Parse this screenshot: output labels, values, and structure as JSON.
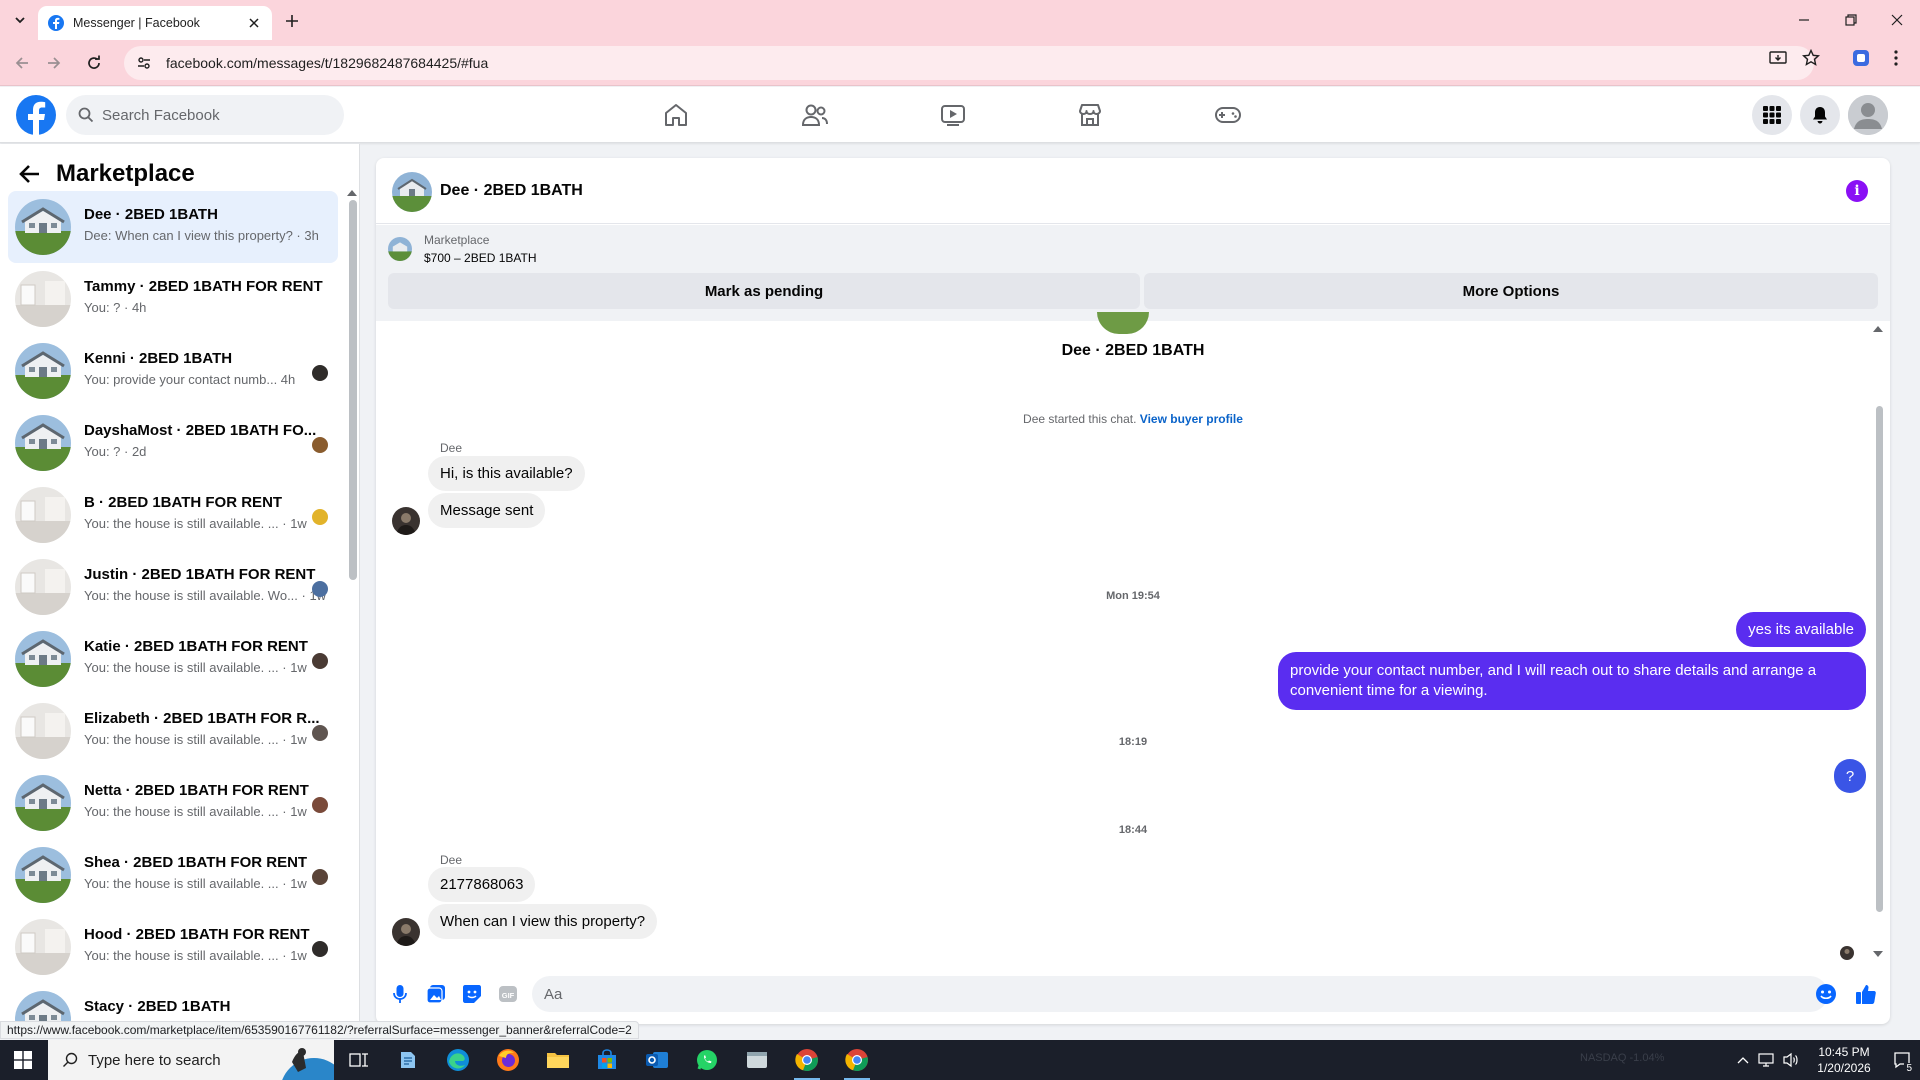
{
  "browser": {
    "tab_title": "Messenger | Facebook",
    "url": "facebook.com/messages/t/1829682487684425/#fua",
    "status_url": "https://www.facebook.com/marketplace/item/653590167761182/?referralSurface=messenger_banner&referralCode=2"
  },
  "header": {
    "search_placeholder": "Search Facebook",
    "nav": [
      "home-icon",
      "friends-icon",
      "video-icon",
      "marketplace-icon",
      "gaming-icon"
    ]
  },
  "sidebar": {
    "title": "Marketplace",
    "conversations": [
      {
        "name": "Dee · 2BED 1BATH",
        "preview": "Dee: When can I view this property? · 3h",
        "active": true,
        "thumb": "house"
      },
      {
        "name": "Tammy · 2BED 1BATH FOR RENT",
        "preview": "You: ? · 4h",
        "thumb": "room"
      },
      {
        "name": "Kenni · 2BED 1BATH",
        "preview": "You: provide your contact numb...   4h",
        "thumb": "house"
      },
      {
        "name": "DayshaMost · 2BED 1BATH FO...",
        "preview": "You: ? · 2d",
        "thumb": "house"
      },
      {
        "name": "B · 2BED 1BATH FOR RENT",
        "preview": "You: the house is still available. ...  · 1w",
        "thumb": "room"
      },
      {
        "name": "Justin · 2BED 1BATH FOR RENT",
        "preview": "You: the house is still available. Wo... · 1w",
        "thumb": "room"
      },
      {
        "name": "Katie · 2BED 1BATH FOR RENT",
        "preview": "You: the house is still available. ...  · 1w",
        "thumb": "house"
      },
      {
        "name": "Elizabeth · 2BED 1BATH FOR R...",
        "preview": "You: the house is still available. ...  · 1w",
        "thumb": "room"
      },
      {
        "name": "Netta · 2BED 1BATH FOR RENT",
        "preview": "You: the house is still available. ...  · 1w",
        "thumb": "house"
      },
      {
        "name": "Shea · 2BED 1BATH FOR RENT",
        "preview": "You: the house is still available. ...  · 1w",
        "thumb": "house"
      },
      {
        "name": "Hood · 2BED 1BATH FOR RENT",
        "preview": "You: the house is still available. ...  · 1w",
        "thumb": "room"
      },
      {
        "name": "Stacy · 2BED 1BATH",
        "preview": "",
        "thumb": "house"
      }
    ]
  },
  "chat": {
    "title": "Dee · 2BED 1BATH",
    "banner": {
      "label": "Marketplace",
      "price": "$700 – 2BED 1BATH",
      "mark_pending": "Mark as pending",
      "more_options": "More Options"
    },
    "intro_name": "Dee · 2BED 1BATH",
    "started_text": "Dee started this chat.",
    "view_profile": "View buyer profile",
    "sender": "Dee",
    "msg1": "Hi, is this available?",
    "msg2": "Message sent",
    "stamp1": "Mon 19:54",
    "out1": "yes its available",
    "out2": "provide your contact number, and I will reach out to share details and arrange a convenient time for a viewing.",
    "stamp2": "18:19",
    "out3": "?",
    "stamp3": "18:44",
    "sender2": "Dee",
    "msg3": "2177868063",
    "msg4": "When can I view this property?",
    "composer_placeholder": "Aa"
  },
  "taskbar": {
    "search_placeholder": "Type here to search",
    "ticker": "NASDAQ  -1.04%",
    "time": "10:45 PM",
    "date": "1/20/2026",
    "notification_count": "5"
  },
  "colors": {
    "chrome": "#fbd5dc",
    "fb_blue": "#1877f2",
    "outgoing": "#5a2df0",
    "info": "#8a0ff5"
  }
}
